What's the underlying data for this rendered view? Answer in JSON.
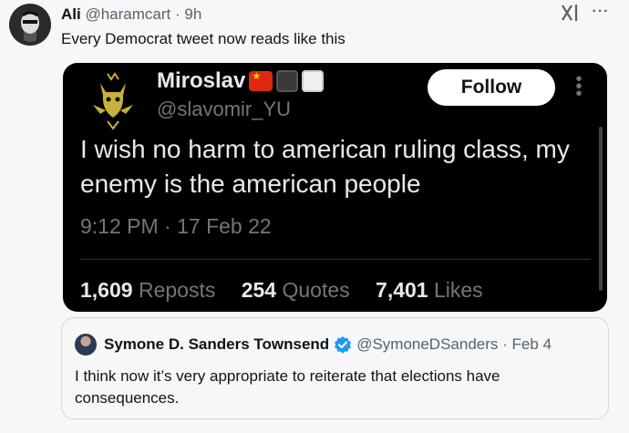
{
  "post": {
    "author_name": "Ali",
    "author_handle": "@haramcart",
    "separator": "·",
    "time_ago": "9h",
    "text": "Every Democrat tweet now reads like this",
    "more_label": "···"
  },
  "embedded": {
    "name": "Miroslav",
    "handle": "@slavomir_YU",
    "follow_label": "Follow",
    "more_label": "⋮",
    "text": "I wish no harm to american ruling class, my enemy is the american people",
    "timestamp": "9:12 PM · 17 Feb 22",
    "stats": [
      {
        "count": "1,609",
        "label": "Reposts"
      },
      {
        "count": "254",
        "label": "Quotes"
      },
      {
        "count": "7,401",
        "label": "Likes"
      }
    ]
  },
  "quote": {
    "name": "Symone D. Sanders Townsend",
    "handle": "@SymoneDSanders",
    "separator": "·",
    "date": "Feb 4",
    "text": "I think now it’s very appropriate to reiterate that elections have consequences."
  },
  "icons": {
    "top_right": "xai-grok-icon",
    "verified": "verified-badge-icon"
  },
  "colors": {
    "verified_blue": "#1d9bf0",
    "flag_red": "#de2910",
    "card_bg": "#000000"
  }
}
